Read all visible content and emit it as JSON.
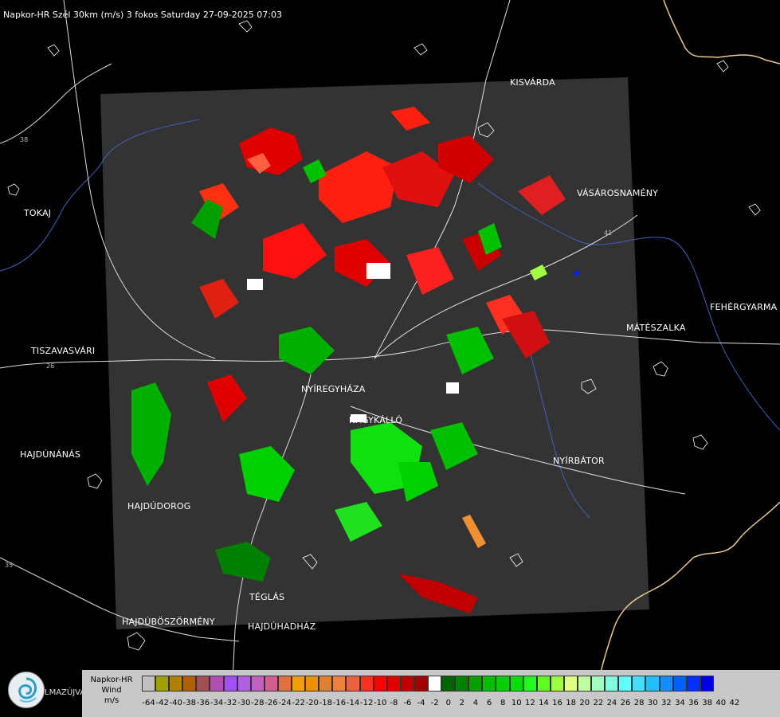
{
  "title": "Napkor-HR Szél 30km (m/s) 3 fokos Saturday 27-09-2025 07:03",
  "cities": [
    {
      "id": "kisvarda",
      "name": "KISVÁRDA"
    },
    {
      "id": "vasarosnameny",
      "name": "VÁSÁROSNAMÉNY"
    },
    {
      "id": "tokaj",
      "name": "TOKAJ"
    },
    {
      "id": "fehergyarmat",
      "name": "FEHÉRGYARMA"
    },
    {
      "id": "mateszalka",
      "name": "MÁTÉSZALKA"
    },
    {
      "id": "tiszavasvari",
      "name": "TISZAVASVÁRI"
    },
    {
      "id": "nyiregyhaza",
      "name": "NYÍREGYHÁZA"
    },
    {
      "id": "nagykallo",
      "name": "NAGYKÁLLÓ"
    },
    {
      "id": "hajdunanas",
      "name": "HAJDÚNÁNÁS"
    },
    {
      "id": "nyirbator",
      "name": "NYÍRBÁTOR"
    },
    {
      "id": "hajdudorog",
      "name": "HAJDÚDOROG"
    },
    {
      "id": "teglas",
      "name": "TÉGLÁS"
    },
    {
      "id": "hajduboszormeny",
      "name": "HAJDÚBÖSZÖRMÉNY"
    },
    {
      "id": "hajduhadhaz",
      "name": "HAJDÚHADHÁZ"
    }
  ],
  "road_numbers": [
    "38",
    "41",
    "26",
    "35"
  ],
  "legend": {
    "title_line1": "Napkor-HR",
    "title_line2": "Wind",
    "title_line3": "m/s",
    "logo_text": "LMAZÚJVÁR",
    "ticks": [
      "-64",
      "-42",
      "-40",
      "-38",
      "-36",
      "-34",
      "-32",
      "-30",
      "-28",
      "-26",
      "-24",
      "-22",
      "-20",
      "-18",
      "-16",
      "-14",
      "-12",
      "-10",
      "-8",
      "-6",
      "-4",
      "-2",
      "0",
      "2",
      "4",
      "6",
      "8",
      "10",
      "12",
      "14",
      "16",
      "18",
      "20",
      "22",
      "24",
      "26",
      "28",
      "30",
      "32",
      "34",
      "36",
      "38",
      "40",
      "42"
    ],
    "colors": [
      "#c0c0c0",
      "#a0a000",
      "#b08000",
      "#b06000",
      "#a05050",
      "#b050b0",
      "#a050ff",
      "#b060e0",
      "#c060c0",
      "#d06090",
      "#e07040",
      "#f0a000",
      "#f09000",
      "#e08030",
      "#f08040",
      "#f06040",
      "#ff3020",
      "#ff0000",
      "#e00000",
      "#c00000",
      "#a00000",
      "#ffffff",
      "#006400",
      "#008000",
      "#00a000",
      "#00c000",
      "#00d000",
      "#00e000",
      "#20ff20",
      "#60ff20",
      "#a0ff40",
      "#e0ff80",
      "#c0ffa0",
      "#a0ffc0",
      "#80ffe0",
      "#60ffff",
      "#40e0ff",
      "#20c0ff",
      "#1090ff",
      "#0060ff",
      "#0030ff",
      "#0000e0"
    ]
  }
}
